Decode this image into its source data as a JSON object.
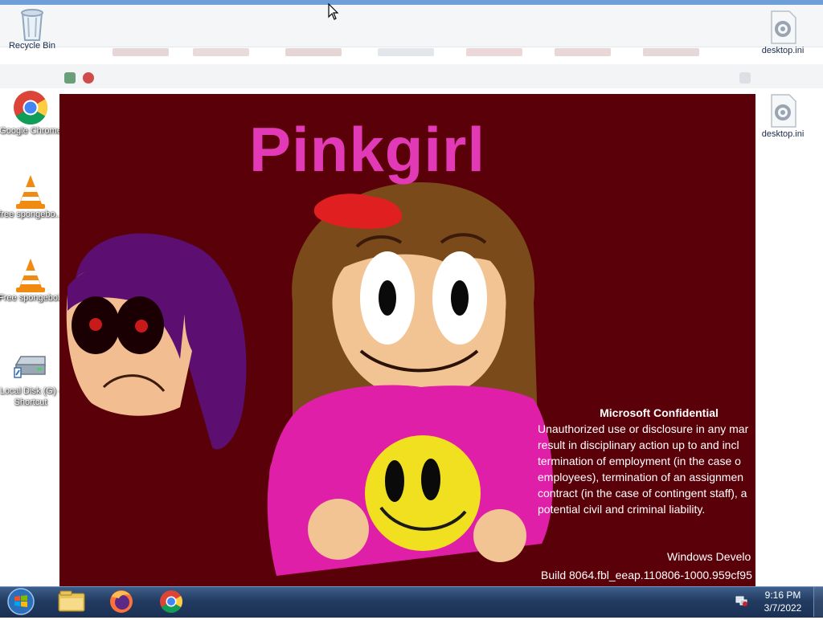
{
  "desktop": {
    "icons": [
      {
        "label": "Recycle Bin",
        "icon": "recycle-bin-icon"
      },
      {
        "label": "Google Chrome",
        "icon": "chrome-icon"
      },
      {
        "label": "free spongebo...",
        "icon": "vlc-icon"
      },
      {
        "label": "Free spongebob ...",
        "icon": "vlc-icon"
      },
      {
        "label": "Local Disk (G) - Shortcut",
        "icon": "drive-icon"
      },
      {
        "label": "desktop.ini",
        "icon": "settings-file-icon"
      },
      {
        "label": "desktop.ini",
        "icon": "settings-file-icon"
      }
    ]
  },
  "picture": {
    "title": "Pinkgirl",
    "colors": {
      "background": "#5a0008",
      "title": "#e23ab6",
      "shirt": "#e01fa8",
      "hair": "#7a4a1a",
      "shadow_girl_hair": "#5c0f70",
      "smiley": "#f0e020"
    }
  },
  "watermark": {
    "title": "Microsoft Confidential",
    "lines": [
      "Unauthorized use or disclosure in any mar",
      "result in disciplinary action up to and incl",
      "termination of employment (in the case o",
      "employees), termination of an assignmen",
      "contract (in the case of contingent staff), a",
      "potential civil and criminal liability."
    ],
    "os": "Windows Develo",
    "build": "Build 8064.fbl_eeap.110806-1000.959cf95"
  },
  "taskbar": {
    "start": "start-orb-icon",
    "pinned": [
      "file-explorer-icon",
      "firefox-icon",
      "chrome-icon"
    ],
    "clock_time": "9:16 PM",
    "clock_date": "3/7/2022"
  }
}
